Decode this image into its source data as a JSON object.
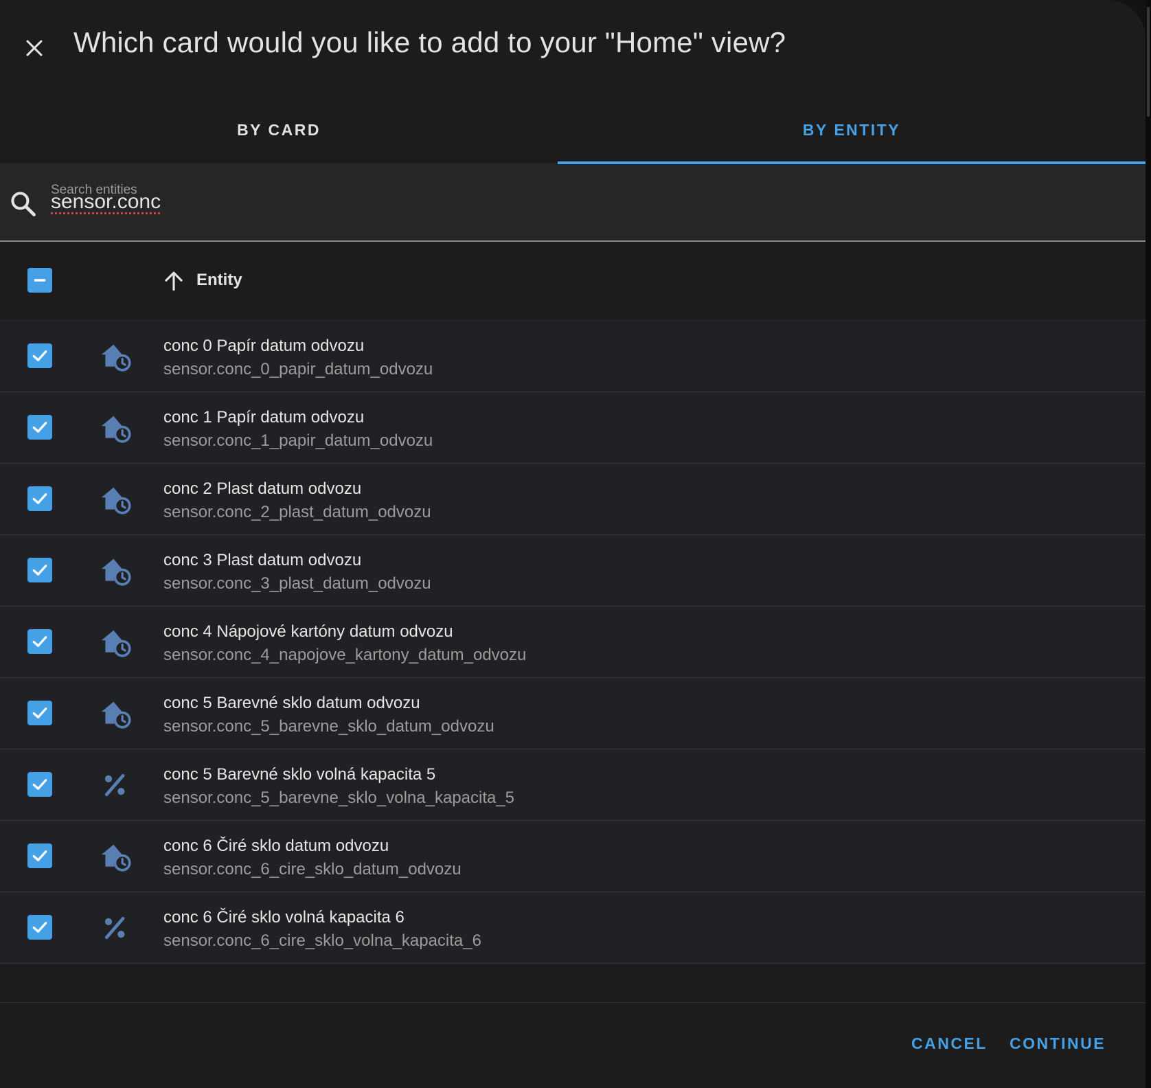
{
  "dialog": {
    "title": "Which card would you like to add to your \"Home\" view?",
    "close_icon": "close-icon"
  },
  "tabs": [
    {
      "label": "BY CARD",
      "active": false
    },
    {
      "label": "BY ENTITY",
      "active": true
    }
  ],
  "search": {
    "placeholder": "Search entities",
    "value": "sensor.conc",
    "icon": "search-icon"
  },
  "table": {
    "header": {
      "select_all_state": "indeterminate",
      "sort_icon": "arrow-up-icon",
      "column_label": "Entity"
    },
    "rows": [
      {
        "name": "conc 0 Papír datum odvozu",
        "entity_id": "sensor.conc_0_papir_datum_odvozu",
        "icon": "home-clock-icon",
        "checked": true
      },
      {
        "name": "conc 1 Papír datum odvozu",
        "entity_id": "sensor.conc_1_papir_datum_odvozu",
        "icon": "home-clock-icon",
        "checked": true
      },
      {
        "name": "conc 2 Plast datum odvozu",
        "entity_id": "sensor.conc_2_plast_datum_odvozu",
        "icon": "home-clock-icon",
        "checked": true
      },
      {
        "name": "conc 3 Plast datum odvozu",
        "entity_id": "sensor.conc_3_plast_datum_odvozu",
        "icon": "home-clock-icon",
        "checked": true
      },
      {
        "name": "conc 4 Nápojové kartóny datum odvozu",
        "entity_id": "sensor.conc_4_napojove_kartony_datum_odvozu",
        "icon": "home-clock-icon",
        "checked": true
      },
      {
        "name": "conc 5 Barevné sklo datum odvozu",
        "entity_id": "sensor.conc_5_barevne_sklo_datum_odvozu",
        "icon": "home-clock-icon",
        "checked": true
      },
      {
        "name": "conc 5 Barevné sklo volná kapacita 5",
        "entity_id": "sensor.conc_5_barevne_sklo_volna_kapacita_5",
        "icon": "percent-icon",
        "checked": true
      },
      {
        "name": "conc 6 Čiré sklo datum odvozu",
        "entity_id": "sensor.conc_6_cire_sklo_datum_odvozu",
        "icon": "home-clock-icon",
        "checked": true
      },
      {
        "name": "conc 6 Čiré sklo volná kapacita 6",
        "entity_id": "sensor.conc_6_cire_sklo_volna_kapacita_6",
        "icon": "percent-icon",
        "checked": true
      }
    ]
  },
  "footer": {
    "cancel_label": "CANCEL",
    "continue_label": "CONTINUE"
  },
  "colors": {
    "accent": "#45a0e6",
    "icon": "#5a7fb4",
    "dialog_bg": "#1c1c1c",
    "row_bg": "#1f2124"
  }
}
